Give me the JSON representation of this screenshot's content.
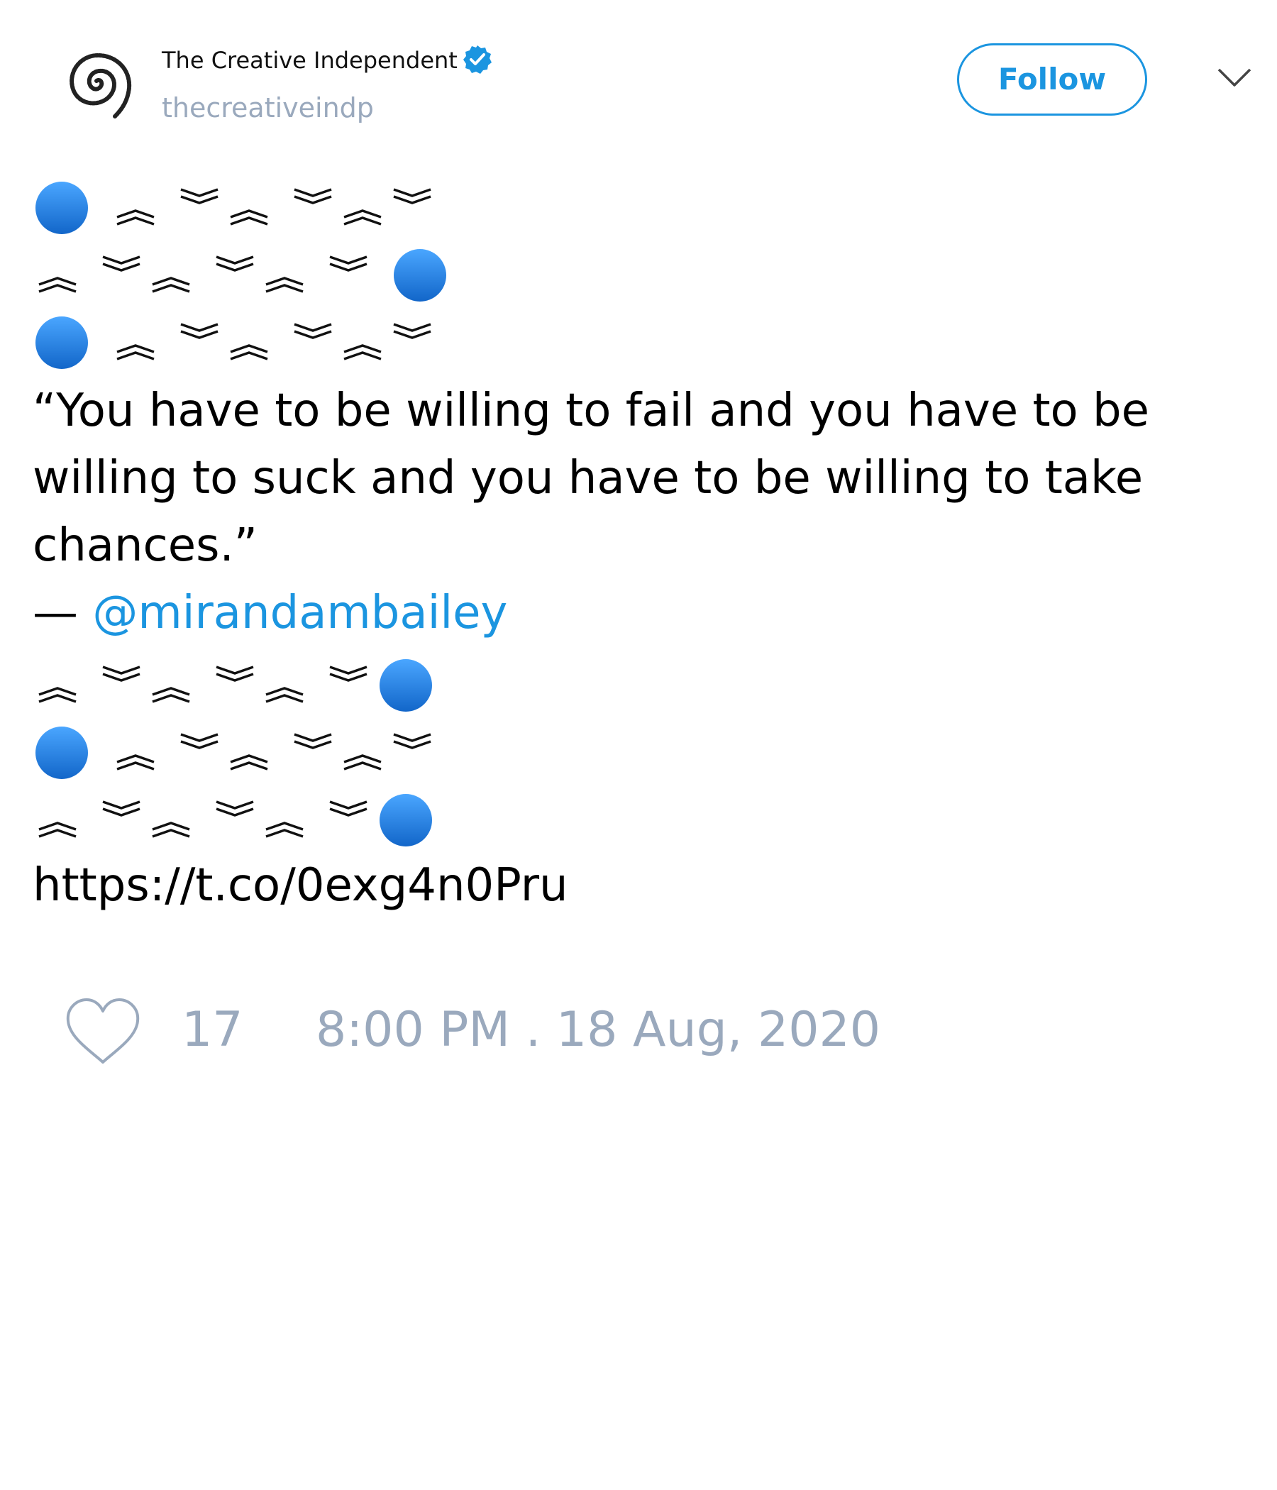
{
  "header": {
    "display_name": "The Creative Independent",
    "username": "thecreativeindp",
    "verified": true,
    "follow_label": "Follow"
  },
  "tweet": {
    "quote_lines": [
      "“You have to be willing to fail and you have to be",
      "willing to suck and you have to be willing to take",
      "chances.”"
    ],
    "attribution_dash": "—",
    "mention": "@mirandambailey",
    "link": "https://t.co/0exg4n0Pru"
  },
  "footer": {
    "like_count": "17",
    "timestamp": "8:00 PM . 18 Aug, 2020"
  },
  "colors": {
    "accent": "#1b95e0",
    "muted": "#9aa9bd",
    "text": "#000000",
    "dot_light": "#4aa6ff",
    "dot_dark": "#1266c9"
  },
  "icons": {
    "avatar": "spiral-logo",
    "verified": "verified-badge-icon",
    "menu": "chevron-down-icon",
    "like": "heart-icon",
    "pattern_up": "double-caret-up",
    "pattern_down": "double-caret-down",
    "pattern_dot": "blue-circle-emoji"
  }
}
